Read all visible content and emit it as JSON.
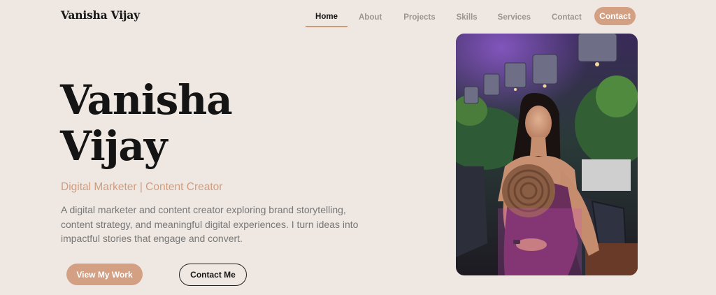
{
  "header": {
    "brand": "Vanisha Vijay",
    "nav": [
      "Home",
      "About",
      "Projects",
      "Skills",
      "Services",
      "Contact"
    ],
    "active_nav": "Home",
    "cta_label": "Contact"
  },
  "hero": {
    "name_line1": "Vanisha",
    "name_line2": "Vijay",
    "subtitle": "Digital Marketer | Content Creator",
    "description": "A digital marketer and content creator exploring brand storytelling, content strategy, and meaningful digital experiences. I turn ideas into impactful stories that engage and convert.",
    "primary_button": "View My Work",
    "secondary_button": "Contact Me"
  },
  "colors": {
    "background": "#efe8e2",
    "accent": "#d3a083",
    "text_dark": "#141414",
    "text_muted": "#777777"
  },
  "icons": [
    "profile-photo"
  ]
}
